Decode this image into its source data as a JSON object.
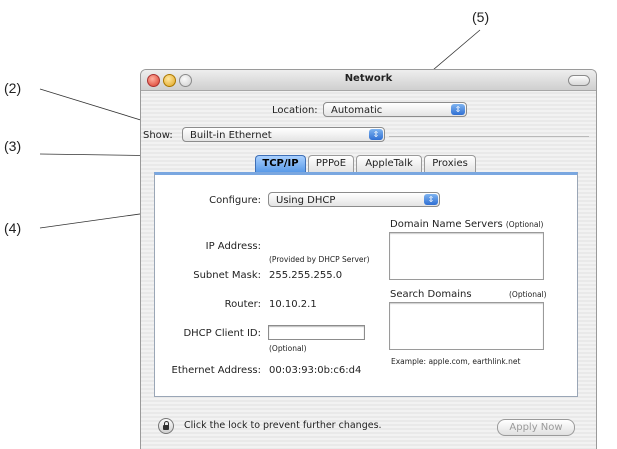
{
  "callouts": {
    "c2": "(2)",
    "c3": "(3)",
    "c4": "(4)",
    "c5": "(5)"
  },
  "window": {
    "title": "Network"
  },
  "location": {
    "label": "Location:",
    "value": "Automatic"
  },
  "show": {
    "label": "Show:",
    "value": "Built-in Ethernet"
  },
  "tabs": [
    {
      "label": "TCP/IP",
      "active": true
    },
    {
      "label": "PPPoE",
      "active": false
    },
    {
      "label": "AppleTalk",
      "active": false
    },
    {
      "label": "Proxies",
      "active": false
    }
  ],
  "configure": {
    "label": "Configure:",
    "value": "Using DHCP"
  },
  "ip": {
    "label": "IP Address:",
    "note": "(Provided by DHCP Server)"
  },
  "subnet": {
    "label": "Subnet Mask:",
    "value": "255.255.255.0"
  },
  "router": {
    "label": "Router:",
    "value": "10.10.2.1"
  },
  "dhcp": {
    "label": "DHCP Client ID:",
    "value": "",
    "note": "(Optional)"
  },
  "ethernet": {
    "label": "Ethernet Address:",
    "value": "00:03:93:0b:c6:d4"
  },
  "dns": {
    "label": "Domain Name Servers",
    "optional": "(Optional)"
  },
  "search": {
    "label": "Search Domains",
    "optional": "(Optional)"
  },
  "example": "Example: apple.com, earthlink.net",
  "footer": {
    "lock_text": "Click the lock to prevent further changes.",
    "apply_label": "Apply Now"
  },
  "colors": {
    "tab_active": "#5a9ae8",
    "panel_accent": "#7aa7e0",
    "popup_arrow": "#2f6fd3"
  }
}
